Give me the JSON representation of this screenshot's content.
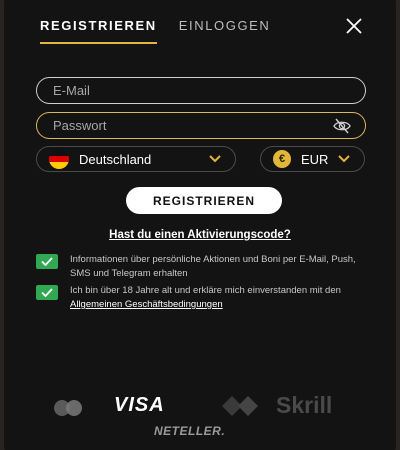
{
  "tabs": {
    "register": "REGISTRIEREN",
    "login": "EINLOGGEN"
  },
  "form": {
    "email_placeholder": "E-Mail",
    "password_placeholder": "Passwort",
    "country": "Deutschland",
    "currency": "EUR",
    "currency_symbol": "€",
    "submit_label": "REGISTRIEREN",
    "activation_link": "Hast du einen Aktivierungscode?"
  },
  "consents": {
    "marketing_text": "Informationen über persönliche Aktionen und Boni per E-Mail, Push, SMS und Telegram erhalten",
    "marketing_checked": true,
    "terms_prefix": "Ich bin über 18 Jahre alt und erkläre mich einverstanden mit den ",
    "terms_link": "Allgemeinen Geschäftsbedingungen",
    "terms_checked": true
  },
  "payments": {
    "visa": "VISA",
    "skrill": "Skrill",
    "neteller": "NETELLER."
  },
  "colors": {
    "accent": "#e2b63a",
    "check": "#32a852",
    "background": "#131313"
  }
}
